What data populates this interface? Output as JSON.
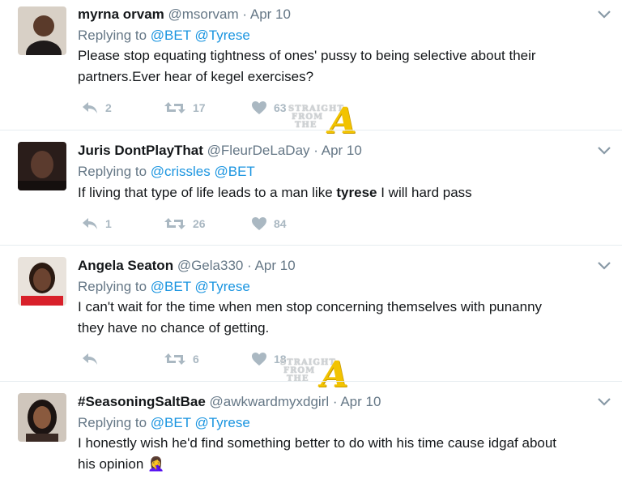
{
  "tweets": [
    {
      "name": "myrna orvam",
      "handle": "@msorvam",
      "separator": "·",
      "date": "Apr 10",
      "replying_label": "Replying to",
      "mentions": [
        "@BET",
        "@Tyrese"
      ],
      "text_line1": "Please stop equating tightness of ones' pussy to being selective about their",
      "text_line2": "partners.Ever hear of kegel exercises?",
      "replies": "2",
      "retweets": "17",
      "likes": "63"
    },
    {
      "name": "Juris DontPlayThat",
      "handle": "@FleurDeLaDay",
      "separator": "·",
      "date": "Apr 10",
      "replying_label": "Replying to",
      "mentions": [
        "@crissles",
        "@BET"
      ],
      "text_before": "If living that type of life leads to a man like ",
      "text_bold": "tyrese",
      "text_after": " I will hard pass",
      "replies": "1",
      "retweets": "26",
      "likes": "84"
    },
    {
      "name": "Angela Seaton",
      "handle": "@Gela330",
      "separator": "·",
      "date": "Apr 10",
      "replying_label": "Replying to",
      "mentions": [
        "@BET",
        "@Tyrese"
      ],
      "text_line1": "I can't wait for the time when men stop concerning themselves with punanny",
      "text_line2": "they have no chance of getting.",
      "replies": "",
      "retweets": "6",
      "likes": "18"
    },
    {
      "name": "#SeasoningSaltBae",
      "handle": "@awkwardmyxdgirl",
      "separator": "·",
      "date": "Apr 10",
      "replying_label": "Replying to",
      "mentions": [
        "@BET",
        "@Tyrese"
      ],
      "text_line1": "I honestly wish he'd find something better to do with his time cause idgaf about",
      "text_line2": "his opinion",
      "emoji": "🤦‍♀️"
    }
  ],
  "watermark": {
    "line1": "STRAIGHT",
    "line2": "FROM",
    "line3": "THE",
    "letter": "A"
  },
  "icons": [
    "reply-icon",
    "retweet-icon",
    "like-icon",
    "chevron-down-icon"
  ],
  "colors": {
    "mention": "#1b95e0",
    "meta": "#657786",
    "action": "#aab8c2",
    "divider": "#e6ecf0"
  }
}
